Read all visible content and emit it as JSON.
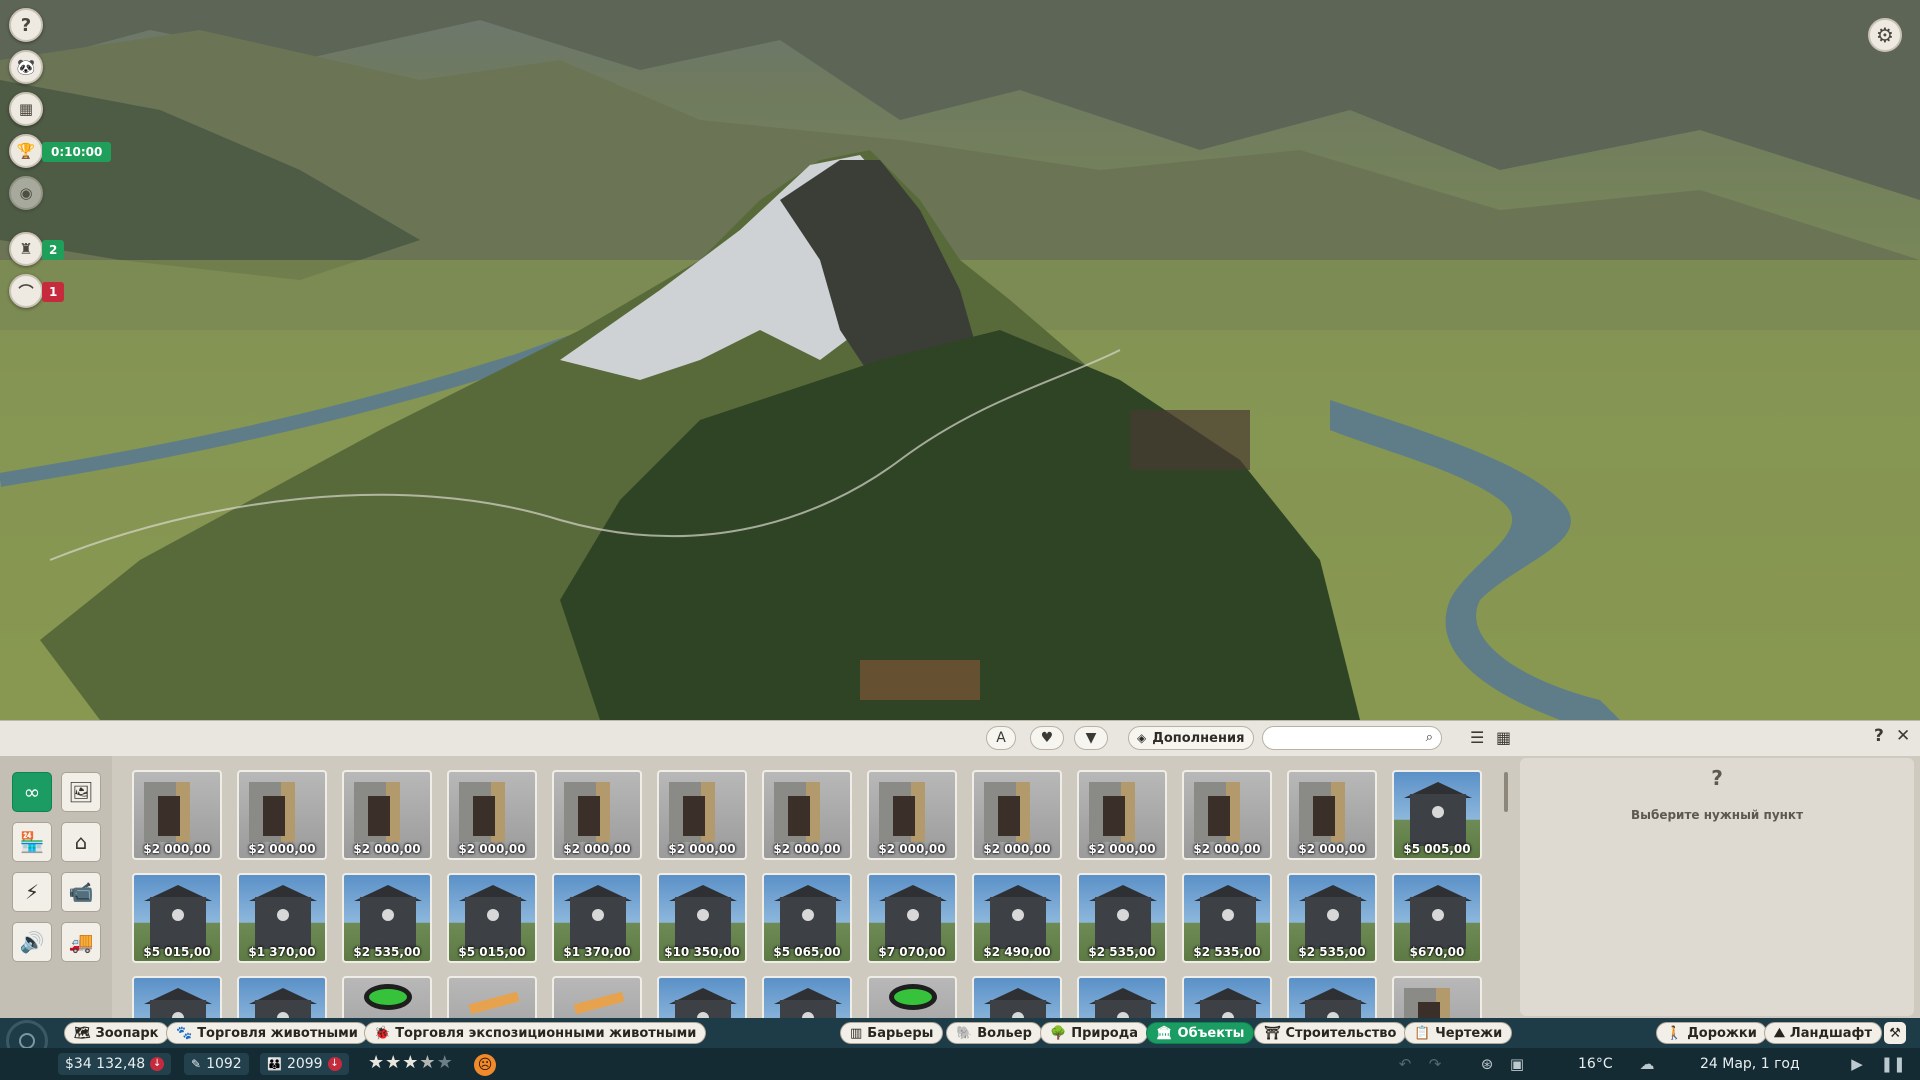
{
  "hud": {
    "timer": "0:10:00",
    "alerts_count": "2",
    "warnings_count": "1"
  },
  "toolbar": {
    "addons_label": "Дополнения",
    "search_placeholder": "",
    "search_value": ""
  },
  "items": [
    {
      "price": "$2 000,00",
      "kind": "shed"
    },
    {
      "price": "$2 000,00",
      "kind": "shed"
    },
    {
      "price": "$2 000,00",
      "kind": "shed"
    },
    {
      "price": "$2 000,00",
      "kind": "shed"
    },
    {
      "price": "$2 000,00",
      "kind": "shed"
    },
    {
      "price": "$2 000,00",
      "kind": "shed"
    },
    {
      "price": "$2 000,00",
      "kind": "shed"
    },
    {
      "price": "$2 000,00",
      "kind": "shed"
    },
    {
      "price": "$2 000,00",
      "kind": "shed"
    },
    {
      "price": "$2 000,00",
      "kind": "shed"
    },
    {
      "price": "$2 000,00",
      "kind": "shed"
    },
    {
      "price": "$2 000,00",
      "kind": "shed"
    },
    {
      "price": "$5 005,00",
      "kind": "house"
    },
    {
      "price": "$5 015,00",
      "kind": "house"
    },
    {
      "price": "$1 370,00",
      "kind": "house"
    },
    {
      "price": "$2 535,00",
      "kind": "house"
    },
    {
      "price": "$5 015,00",
      "kind": "house"
    },
    {
      "price": "$1 370,00",
      "kind": "house"
    },
    {
      "price": "$10 350,00",
      "kind": "house"
    },
    {
      "price": "$5 065,00",
      "kind": "house"
    },
    {
      "price": "$7 070,00",
      "kind": "house"
    },
    {
      "price": "$2 490,00",
      "kind": "house"
    },
    {
      "price": "$2 535,00",
      "kind": "house"
    },
    {
      "price": "$2 535,00",
      "kind": "house"
    },
    {
      "price": "$2 535,00",
      "kind": "house"
    },
    {
      "price": "$670,00",
      "kind": "house"
    },
    {
      "price": "",
      "kind": "house"
    },
    {
      "price": "",
      "kind": "house"
    },
    {
      "price": "",
      "kind": "ring"
    },
    {
      "price": "",
      "kind": "plank"
    },
    {
      "price": "",
      "kind": "plank"
    },
    {
      "price": "",
      "kind": "house"
    },
    {
      "price": "",
      "kind": "house"
    },
    {
      "price": "",
      "kind": "ring"
    },
    {
      "price": "",
      "kind": "house"
    },
    {
      "price": "",
      "kind": "house"
    },
    {
      "price": "",
      "kind": "house"
    },
    {
      "price": "",
      "kind": "house"
    },
    {
      "price": "",
      "kind": "shed"
    }
  ],
  "info": {
    "question": "?",
    "hint": "Выберите нужный пункт"
  },
  "tabs": [
    {
      "label": "Зоопарк",
      "icon": "zoo-icon",
      "glyph": "🗺"
    },
    {
      "label": "Торговля животными",
      "icon": "paw-icon",
      "glyph": "🐾"
    },
    {
      "label": "Торговля экспозиционными животными",
      "icon": "bug-icon",
      "glyph": "🐞"
    },
    {
      "label": "Барьеры",
      "icon": "barrier-icon",
      "glyph": "▥"
    },
    {
      "label": "Вольер",
      "icon": "habitat-icon",
      "glyph": "🐘"
    },
    {
      "label": "Природа",
      "icon": "nature-icon",
      "glyph": "🌳"
    },
    {
      "label": "Объекты",
      "icon": "facility-icon",
      "glyph": "🏛"
    },
    {
      "label": "Строительство",
      "icon": "construction-icon",
      "glyph": "⛩"
    },
    {
      "label": "Чертежи",
      "icon": "blueprint-icon",
      "glyph": "📋"
    },
    {
      "label": "Дорожки",
      "icon": "path-icon",
      "glyph": "🚶"
    },
    {
      "label": "Ландшафт",
      "icon": "terrain-icon",
      "glyph": "⛰"
    }
  ],
  "status": {
    "money": "$34 132,48",
    "conservation_credits": "1092",
    "guests": "2099",
    "rating_stars": 3.5,
    "temperature": "16°C",
    "date": "24 Мар, 1 год"
  },
  "colors": {
    "accent_green": "#1b9c62",
    "alert_red": "#c52a3d",
    "panel_bg": "#cfcac0",
    "bar_bg": "#142b34"
  }
}
